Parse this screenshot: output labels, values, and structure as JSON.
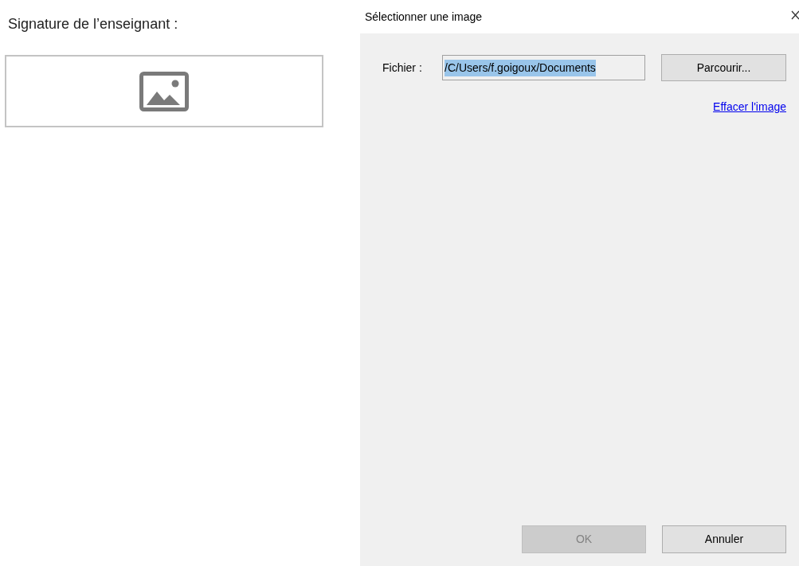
{
  "form": {
    "label": "Signature de l’enseignant :",
    "image_empty": true
  },
  "dialog": {
    "title": "Sélectionner une image",
    "file_label": "Fichier :",
    "file_field": {
      "value": "/C/Users/f.goigoux/Documents",
      "selected": true
    },
    "browse_button": "Parcourir...",
    "clear_link": "Effacer l'image",
    "buttons": [
      {
        "label": "OK",
        "disabled": true
      },
      {
        "label": "Annuler",
        "disabled": false
      }
    ]
  }
}
